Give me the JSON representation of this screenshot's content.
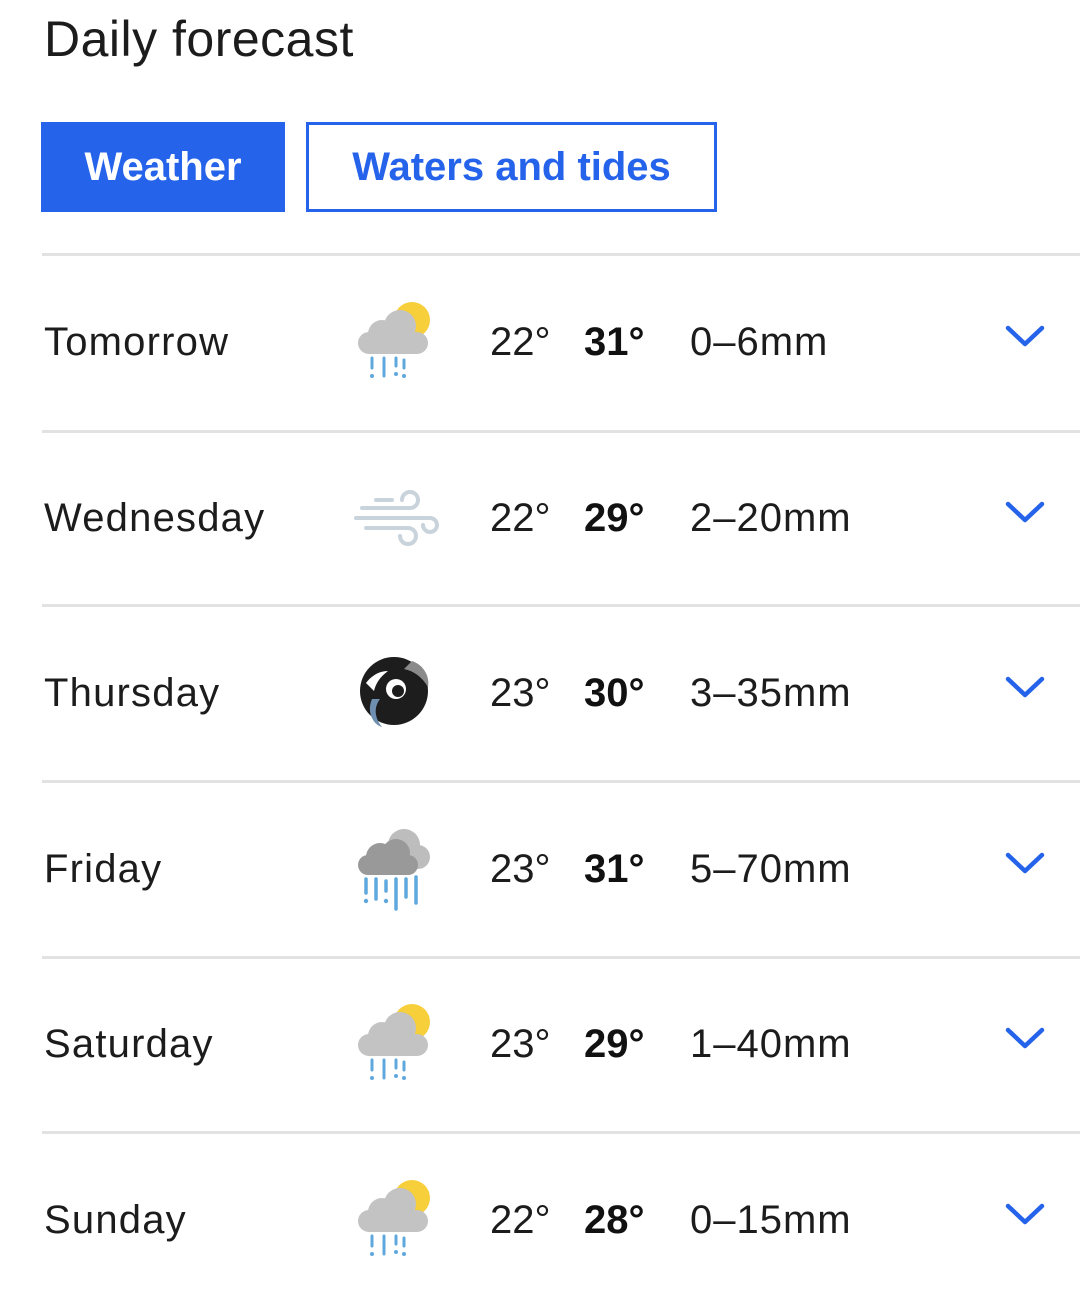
{
  "header": {
    "title": "Daily forecast"
  },
  "tabs": [
    {
      "label": "Weather",
      "active": true
    },
    {
      "label": "Waters and tides",
      "active": false
    }
  ],
  "colors": {
    "accent": "#2563eb",
    "divider": "#e2e2e2",
    "text": "#1c1c1c"
  },
  "forecast": [
    {
      "day": "Tomorrow",
      "icon": "light-rain-sun-icon",
      "min": "22°",
      "max": "31°",
      "rain": "0–6mm"
    },
    {
      "day": "Wednesday",
      "icon": "windy-icon",
      "min": "22°",
      "max": "29°",
      "rain": "2–20mm"
    },
    {
      "day": "Thursday",
      "icon": "cyclone-icon",
      "min": "23°",
      "max": "30°",
      "rain": "3–35mm"
    },
    {
      "day": "Friday",
      "icon": "heavy-rain-icon",
      "min": "23°",
      "max": "31°",
      "rain": "5–70mm"
    },
    {
      "day": "Saturday",
      "icon": "light-rain-sun-icon",
      "min": "23°",
      "max": "29°",
      "rain": "1–40mm"
    },
    {
      "day": "Sunday",
      "icon": "light-rain-sun-icon",
      "min": "22°",
      "max": "28°",
      "rain": "0–15mm"
    }
  ],
  "expand_icon": "chevron-down-icon"
}
